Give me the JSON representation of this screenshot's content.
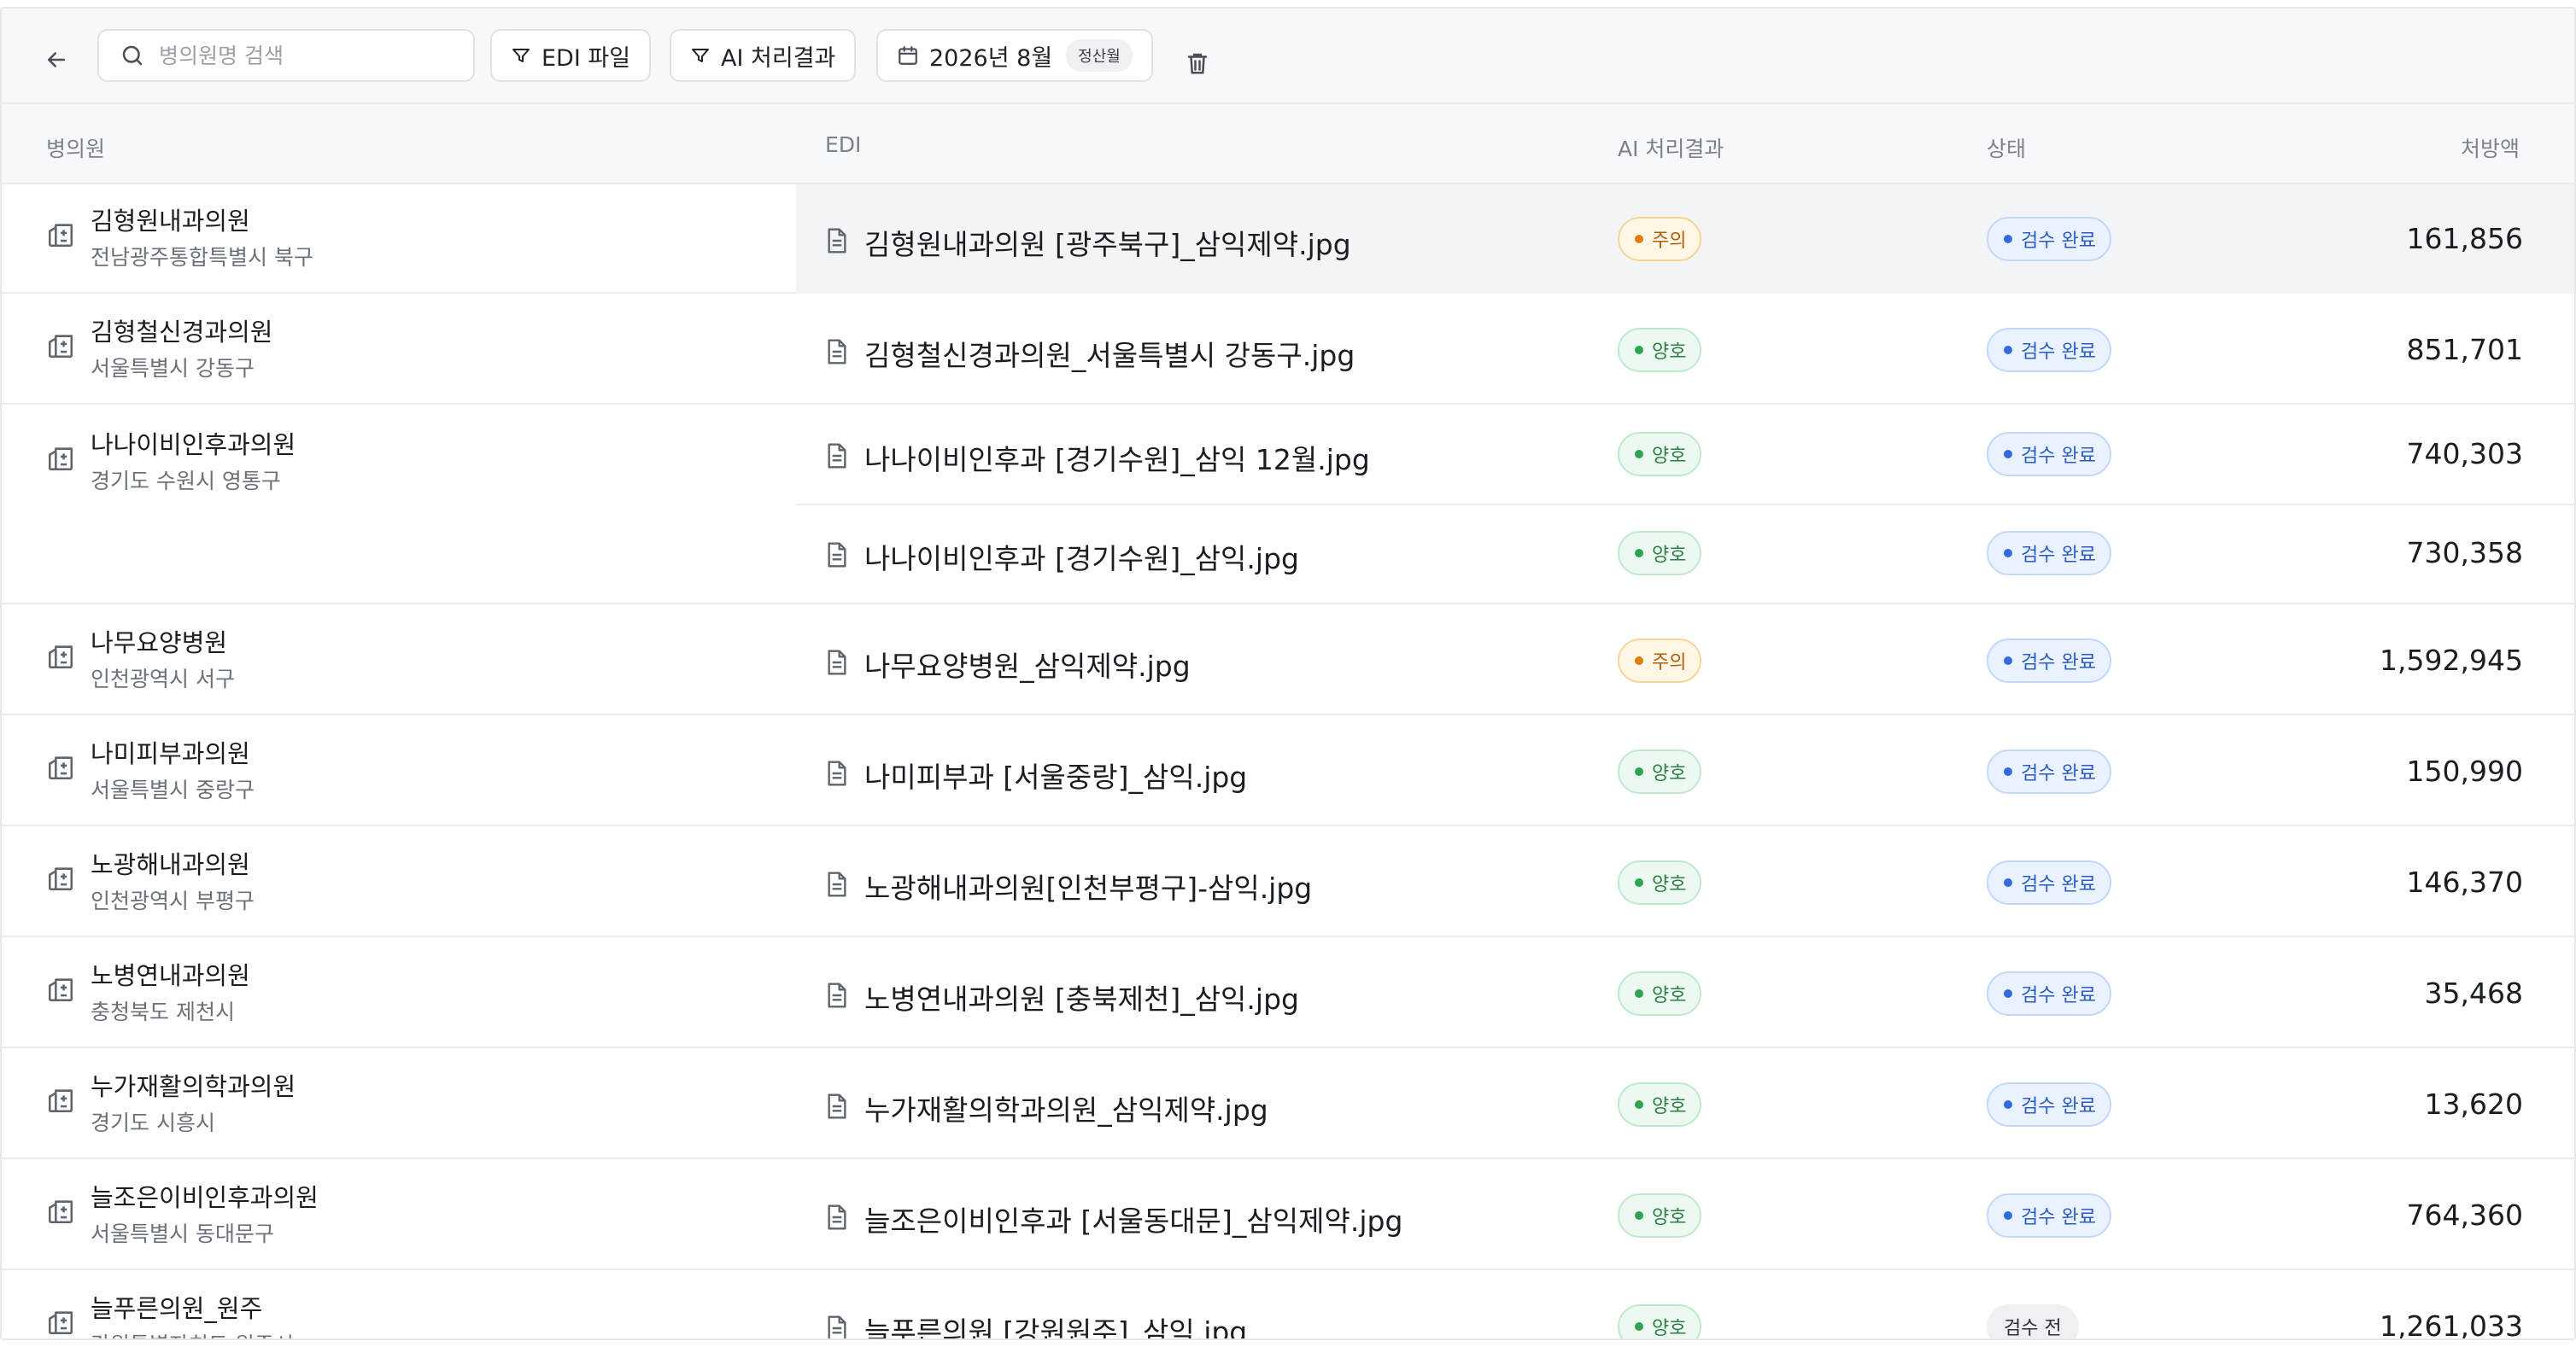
{
  "toolbar": {
    "search_placeholder": "병의원명 검색",
    "edi_filter_label": "EDI 파일",
    "ai_filter_label": "AI 처리결과",
    "date_label": "2026년 8월",
    "date_badge": "정산월"
  },
  "columns": {
    "hospital": "병의원",
    "edi": "EDI",
    "ai": "AI 처리결과",
    "status": "상태",
    "amount": "처방액"
  },
  "groups": [
    {
      "name": "김형원내과의원",
      "address": "전남광주통합특별시 북구",
      "files": [
        {
          "file": "김형원내과의원 [광주북구]_삼익제약.jpg",
          "ai": "주의",
          "ai_level": "warn",
          "status": "검수 완료",
          "status_type": "done",
          "amount": "161,856"
        }
      ]
    },
    {
      "name": "김형철신경과의원",
      "address": "서울특별시 강동구",
      "files": [
        {
          "file": "김형철신경과의원_서울특별시 강동구.jpg",
          "ai": "양호",
          "ai_level": "good",
          "status": "검수 완료",
          "status_type": "done",
          "amount": "851,701"
        }
      ]
    },
    {
      "name": "나나이비인후과의원",
      "address": "경기도 수원시 영통구",
      "files": [
        {
          "file": "나나이비인후과 [경기수원]_삼익 12월.jpg",
          "ai": "양호",
          "ai_level": "good",
          "status": "검수 완료",
          "status_type": "done",
          "amount": "740,303"
        },
        {
          "file": "나나이비인후과 [경기수원]_삼익.jpg",
          "ai": "양호",
          "ai_level": "good",
          "status": "검수 완료",
          "status_type": "done",
          "amount": "730,358"
        }
      ]
    },
    {
      "name": "나무요양병원",
      "address": "인천광역시 서구",
      "files": [
        {
          "file": "나무요양병원_삼익제약.jpg",
          "ai": "주의",
          "ai_level": "warn",
          "status": "검수 완료",
          "status_type": "done",
          "amount": "1,592,945"
        }
      ]
    },
    {
      "name": "나미피부과의원",
      "address": "서울특별시 중랑구",
      "files": [
        {
          "file": "나미피부과 [서울중랑]_삼익.jpg",
          "ai": "양호",
          "ai_level": "good",
          "status": "검수 완료",
          "status_type": "done",
          "amount": "150,990"
        }
      ]
    },
    {
      "name": "노광해내과의원",
      "address": "인천광역시 부평구",
      "files": [
        {
          "file": "노광해내과의원[인천부평구]-삼익.jpg",
          "ai": "양호",
          "ai_level": "good",
          "status": "검수 완료",
          "status_type": "done",
          "amount": "146,370"
        }
      ]
    },
    {
      "name": "노병연내과의원",
      "address": "충청북도 제천시",
      "files": [
        {
          "file": "노병연내과의원 [충북제천]_삼익.jpg",
          "ai": "양호",
          "ai_level": "good",
          "status": "검수 완료",
          "status_type": "done",
          "amount": "35,468"
        }
      ]
    },
    {
      "name": "누가재활의학과의원",
      "address": "경기도 시흥시",
      "files": [
        {
          "file": "누가재활의학과의원_삼익제약.jpg",
          "ai": "양호",
          "ai_level": "good",
          "status": "검수 완료",
          "status_type": "done",
          "amount": "13,620"
        }
      ]
    },
    {
      "name": "늘조은이비인후과의원",
      "address": "서울특별시 동대문구",
      "files": [
        {
          "file": "늘조은이비인후과 [서울동대문]_삼익제약.jpg",
          "ai": "양호",
          "ai_level": "good",
          "status": "검수 완료",
          "status_type": "done",
          "amount": "764,360"
        }
      ]
    },
    {
      "name": "늘푸른의원_원주",
      "address": "강원특별자치도 원주시",
      "files": [
        {
          "file": "늘푸른의원 [강원원주]_삼익.jpg",
          "ai": "양호",
          "ai_level": "good",
          "status": "검수 전",
          "status_type": "pending",
          "amount": "1,261,033"
        }
      ]
    }
  ]
}
